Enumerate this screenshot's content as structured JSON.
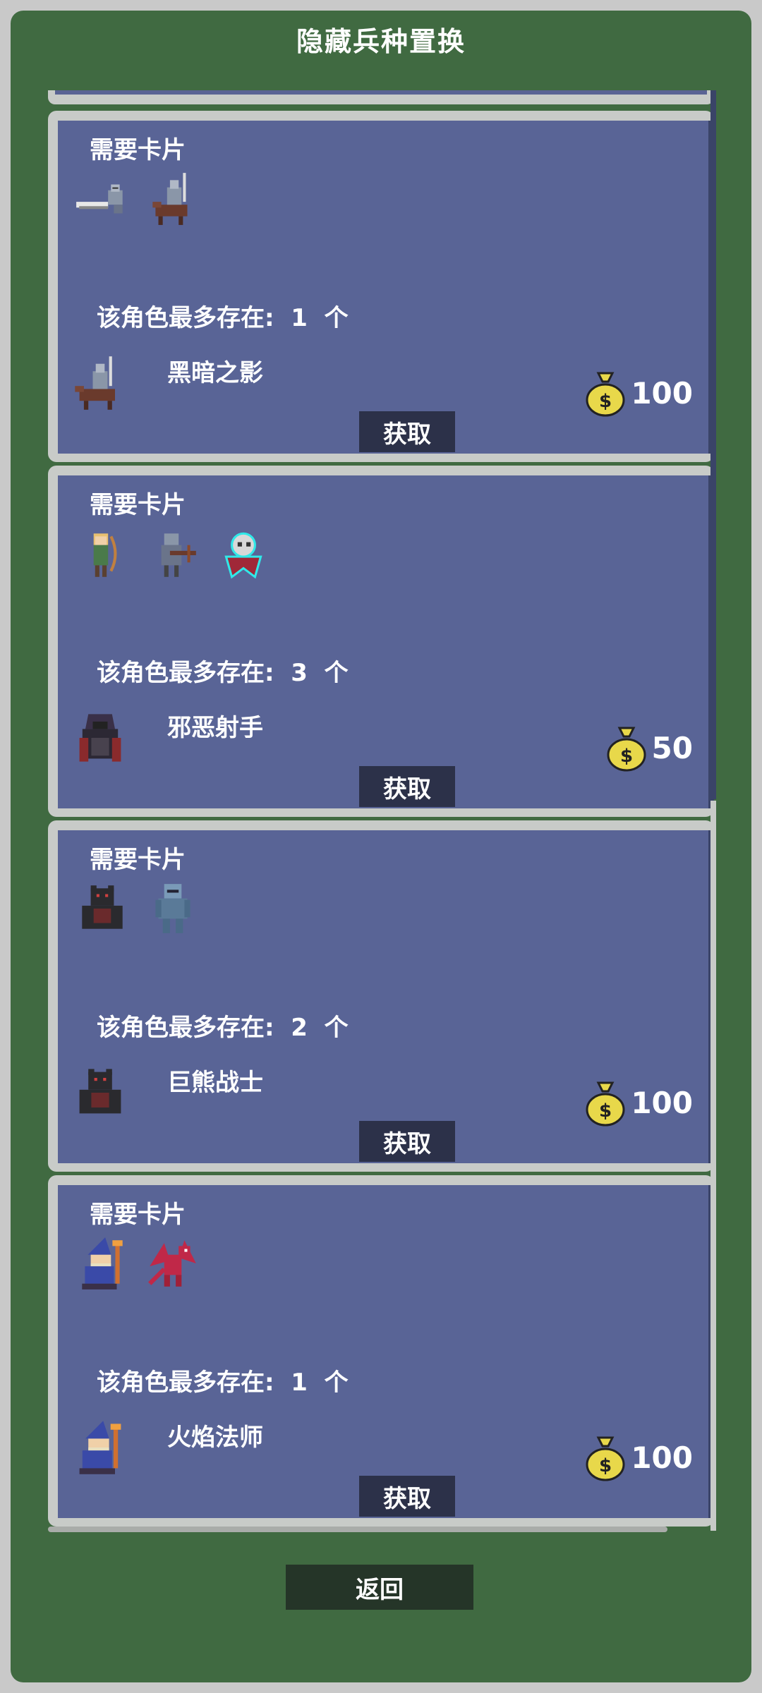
{
  "title": "隐藏兵种置换",
  "need_label": "需要卡片",
  "limit_prefix": "该角色最多存在:",
  "limit_suffix": "个",
  "get_label": "获取",
  "back_label": "返回",
  "colors": {
    "panel": "#406a41",
    "card": "#596496",
    "button": "#2c3149",
    "back_button": "#253528"
  },
  "cards": [
    {
      "name": "黑暗之影",
      "limit": "1",
      "price": "100",
      "required": [
        "flying-knight-icon",
        "mounted-knight-icon"
      ],
      "hero_icon": "mounted-knight-icon"
    },
    {
      "name": "邪恶射手",
      "limit": "3",
      "price": "50",
      "required": [
        "archer-icon",
        "crossbowman-icon",
        "ghost-icon"
      ],
      "hero_icon": "hooded-archer-icon"
    },
    {
      "name": "巨熊战士",
      "limit": "2",
      "price": "100",
      "required": [
        "bear-warrior-icon",
        "armored-knight-icon"
      ],
      "hero_icon": "bear-warrior-icon"
    },
    {
      "name": "火焰法师",
      "limit": "1",
      "price": "100",
      "required": [
        "wizard-icon",
        "red-dragon-icon"
      ],
      "hero_icon": "wizard-icon"
    }
  ]
}
